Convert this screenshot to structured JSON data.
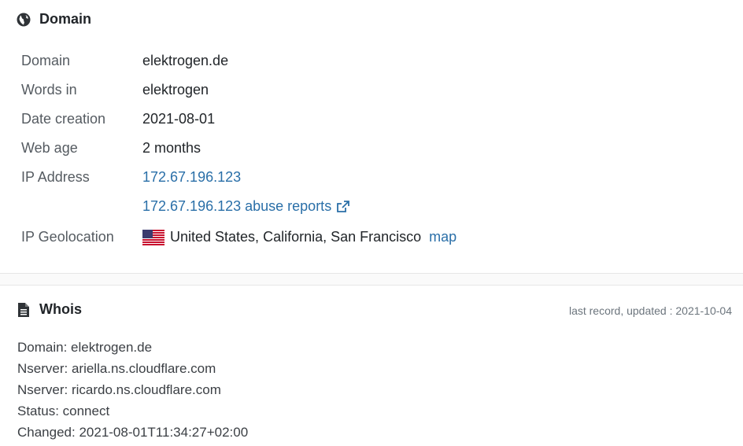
{
  "domain_section": {
    "title": "Domain",
    "icon": "globe-icon",
    "rows": [
      {
        "label": "Domain",
        "value": "elektrogen.de"
      },
      {
        "label": "Words in",
        "value": "elektrogen"
      },
      {
        "label": "Date creation",
        "value": "2021-08-01"
      },
      {
        "label": "Web age",
        "value": "2 months"
      },
      {
        "label": "IP Address",
        "value": "172.67.196.123"
      },
      {
        "label": "",
        "value": "172.67.196.123 abuse reports"
      },
      {
        "label": "IP Geolocation",
        "value": "United States, California, San Francisco",
        "link": "map"
      }
    ]
  },
  "whois_section": {
    "title": "Whois",
    "icon": "document-icon",
    "updated": "last record, updated : 2021-10-04",
    "lines": [
      "Domain: elektrogen.de",
      "Nserver: ariella.ns.cloudflare.com",
      "Nserver: ricardo.ns.cloudflare.com",
      "Status: connect",
      "Changed: 2021-08-01T11:34:27+02:00"
    ]
  },
  "colors": {
    "link": "#2a6fa8",
    "label": "#555b61",
    "text": "#212529"
  }
}
